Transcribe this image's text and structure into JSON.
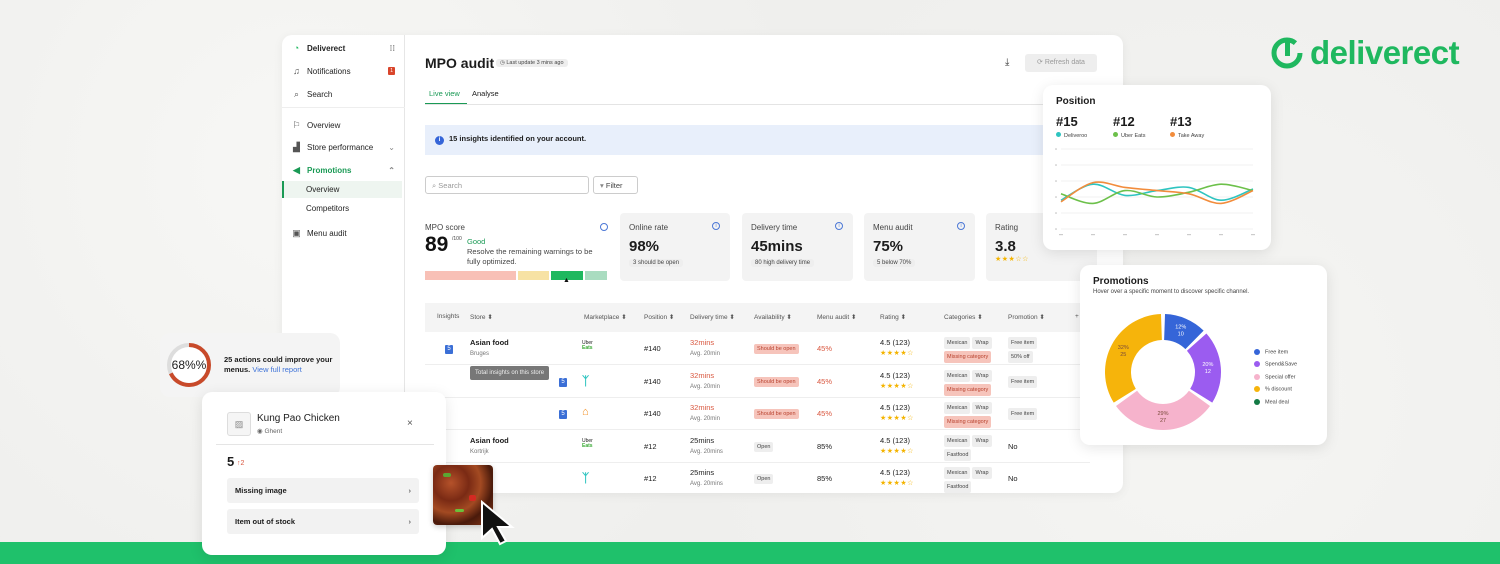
{
  "brand": {
    "logo_text": "deliverect",
    "color": "#1fc16b"
  },
  "sidebar": {
    "app": "Deliverect",
    "items": [
      {
        "label": "Notifications",
        "badge": "1"
      },
      {
        "label": "Search"
      },
      {
        "label": "Overview"
      },
      {
        "label": "Store performance"
      },
      {
        "label": "Promotions"
      },
      {
        "label": "Overview"
      },
      {
        "label": "Competitors"
      },
      {
        "label": "Menu audit"
      }
    ]
  },
  "header": {
    "title": "MPO audit",
    "updated": "Last update 3 mins ago",
    "refresh": "Refresh data",
    "tabs": [
      "Live view",
      "Analyse"
    ]
  },
  "banner": "15 insights identified on your account.",
  "search": {
    "placeholder": "Search",
    "filter": "Filter"
  },
  "score": {
    "label": "MPO score",
    "value": "89",
    "max": "/100",
    "status": "Good",
    "desc": "Resolve the remaining warnings to be fully optimized."
  },
  "kpis": [
    {
      "label": "Online rate",
      "value": "98%",
      "note": "3 should be open"
    },
    {
      "label": "Delivery time",
      "value": "45mins",
      "note": "80 high delivery time"
    },
    {
      "label": "Menu audit",
      "value": "75%",
      "note": "5 below 70%"
    },
    {
      "label": "Rating",
      "value": "3.8",
      "stars": "★★★☆☆"
    }
  ],
  "table": {
    "headers": [
      "Insights",
      "Store ⬍",
      "Marketplace ⬍",
      "Position ⬍",
      "Delivery time ⬍",
      "Availability ⬍",
      "Menu audit ⬍",
      "Rating ⬍",
      "Categories ⬍",
      "Promotion ⬍",
      "+"
    ],
    "tooltip": "Total insights on this store",
    "rows": [
      {
        "insights": "5",
        "store": "Asian food",
        "city": "Bruges",
        "market": "Uber Eats",
        "position": "#140",
        "delivery": "32mins",
        "avg": "Avg. 20min",
        "availability": "Should be open",
        "menu": "45%",
        "rating": "4.5 (123)",
        "stars": "★★★★☆",
        "cats": [
          "Mexican",
          "Wrap"
        ],
        "catbad": "Missing category",
        "promo": [
          "Free item",
          "50% off"
        ]
      },
      {
        "insights": "5",
        "store": "",
        "city": "",
        "market": "Deliveroo",
        "position": "#140",
        "delivery": "32mins",
        "avg": "Avg. 20min",
        "availability": "Should be open",
        "menu": "45%",
        "rating": "4.5 (123)",
        "stars": "★★★★☆",
        "cats": [
          "Mexican",
          "Wrap"
        ],
        "catbad": "Missing category",
        "promo": [
          "Free item"
        ]
      },
      {
        "insights": "5",
        "store": "",
        "city": "",
        "market": "Takeaway",
        "position": "#140",
        "delivery": "32mins",
        "avg": "Avg. 20min",
        "availability": "Should be open",
        "menu": "45%",
        "rating": "4.5 (123)",
        "stars": "★★★★☆",
        "cats": [
          "Mexican",
          "Wrap"
        ],
        "catbad": "Missing category",
        "promo": [
          "Free item"
        ]
      },
      {
        "insights": "",
        "store": "Asian food",
        "city": "Kortrijk",
        "market": "Uber Eats",
        "position": "#12",
        "delivery": "25mins",
        "avg": "Avg. 20mins",
        "availability": "Open",
        "menu": "85%",
        "rating": "4.5 (123)",
        "stars": "★★★★☆",
        "cats": [
          "Mexican",
          "Wrap",
          "Fastfood"
        ],
        "catbad": "",
        "promo_text": "No"
      },
      {
        "insights": "",
        "store": "",
        "city": "",
        "market": "Deliveroo",
        "position": "#12",
        "delivery": "25mins",
        "avg": "Avg. 20mins",
        "availability": "Open",
        "menu": "85%",
        "rating": "4.5 (123)",
        "stars": "★★★★☆",
        "cats": [
          "Mexican",
          "Wrap",
          "Fastfood"
        ],
        "catbad": "",
        "promo_text": "No"
      }
    ]
  },
  "position_card": {
    "title": "Position",
    "entries": [
      {
        "rank": "#15",
        "name": "Deliveroo",
        "color": "#2ec4c0"
      },
      {
        "rank": "#12",
        "name": "Uber Eats",
        "color": "#6cc04a"
      },
      {
        "rank": "#13",
        "name": "Take Away",
        "color": "#f28c3c"
      }
    ]
  },
  "chart_data": [
    {
      "type": "line",
      "title": "Position",
      "ylim": [
        0,
        5
      ],
      "x": [
        1,
        2,
        3,
        4,
        5,
        6,
        7
      ],
      "series": [
        {
          "name": "Deliveroo",
          "values": [
            1.8,
            2.8,
            2.1,
            2.4,
            2.6,
            1.8,
            2.5
          ]
        },
        {
          "name": "Uber Eats",
          "values": [
            2.2,
            1.6,
            2.4,
            2.0,
            2.3,
            2.8,
            2.4
          ]
        },
        {
          "name": "Take Away",
          "values": [
            1.7,
            2.9,
            2.6,
            2.4,
            2.2,
            1.6,
            2.4
          ]
        }
      ]
    },
    {
      "type": "pie",
      "title": "Promotions",
      "subtitle": "Hover over a specific moment to discover specific channel.",
      "slices": [
        {
          "name": "Free item",
          "percent": 12,
          "count": 10,
          "color": "#3565d8"
        },
        {
          "name": "Spend&Save",
          "percent": 20,
          "count": 12,
          "color": "#9b5cf0"
        },
        {
          "name": "Special offer",
          "percent": 29,
          "count": 27,
          "color": "#f6b3cc"
        },
        {
          "name": "% discount",
          "percent": 32,
          "count": 25,
          "color": "#f6b40b"
        },
        {
          "name": "Meal deal",
          "percent": 0,
          "count": 0,
          "color": "#137a45"
        }
      ]
    }
  ],
  "actions_card": {
    "percent": "68%",
    "value": 68,
    "text": "25 actions could improve your menus.",
    "link": "View full report"
  },
  "item_card": {
    "title": "Kung Pao Chicken",
    "location": "Ghent",
    "count": "5",
    "delta": "↑2",
    "issues": [
      "Missing image",
      "Item out of stock"
    ]
  }
}
